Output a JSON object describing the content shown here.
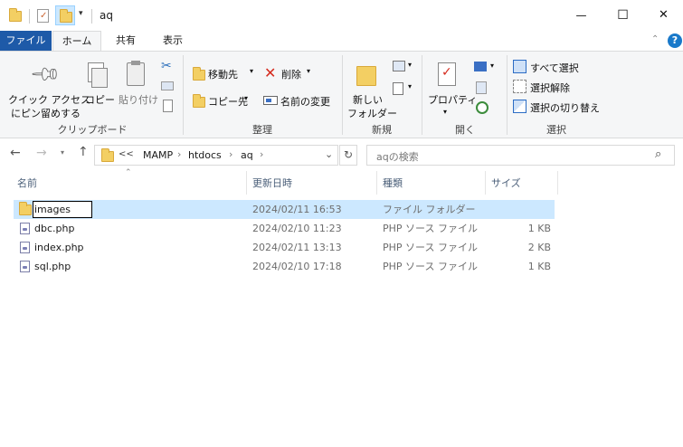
{
  "window": {
    "title": "aq",
    "minimize_glyph": "—",
    "maximize_glyph": "☐",
    "close_glyph": "✕"
  },
  "tabs": [
    {
      "label": "ファイル",
      "active": false,
      "style": "file"
    },
    {
      "label": "ホーム",
      "active": true
    },
    {
      "label": "共有",
      "active": false
    },
    {
      "label": "表示",
      "active": false
    }
  ],
  "ribbon": {
    "clipboard": {
      "label": "クリップボード",
      "pin_line1": "クイック アクセス",
      "pin_line2": "にピン留めする",
      "copy": "コピー",
      "paste": "貼り付け"
    },
    "organize": {
      "label": "整理",
      "move_to": "移動先",
      "copy_to": "コピー先",
      "delete": "削除",
      "rename": "名前の変更"
    },
    "new": {
      "label": "新規",
      "new_folder_line1": "新しい",
      "new_folder_line2": "フォルダー"
    },
    "open": {
      "label": "開く",
      "properties": "プロパティ"
    },
    "select": {
      "label": "選択",
      "select_all": "すべて選択",
      "select_none": "選択解除",
      "invert": "選択の切り替え"
    }
  },
  "address": {
    "breadcrumb": [
      "MAMP",
      "htdocs",
      "aq"
    ],
    "overflow": "<<",
    "search_placeholder": "aqの検索"
  },
  "columns": {
    "name": "名前",
    "modified": "更新日時",
    "type": "種類",
    "size": "サイズ"
  },
  "files": [
    {
      "name": "images",
      "modified": "2024/02/11 16:53",
      "type": "ファイル フォルダー",
      "size": "",
      "kind": "folder",
      "selected": true,
      "renaming": true
    },
    {
      "name": "dbc.php",
      "modified": "2024/02/10 11:23",
      "type": "PHP ソース ファイル",
      "size": "1 KB",
      "kind": "php"
    },
    {
      "name": "index.php",
      "modified": "2024/02/11 13:13",
      "type": "PHP ソース ファイル",
      "size": "2 KB",
      "kind": "php"
    },
    {
      "name": "sql.php",
      "modified": "2024/02/10 17:18",
      "type": "PHP ソース ファイル",
      "size": "1 KB",
      "kind": "php"
    }
  ],
  "colors": {
    "accent": "#1979ca",
    "file_tab": "#1e5aa8",
    "selection": "#cce8ff",
    "folder": "#f3cf63"
  }
}
